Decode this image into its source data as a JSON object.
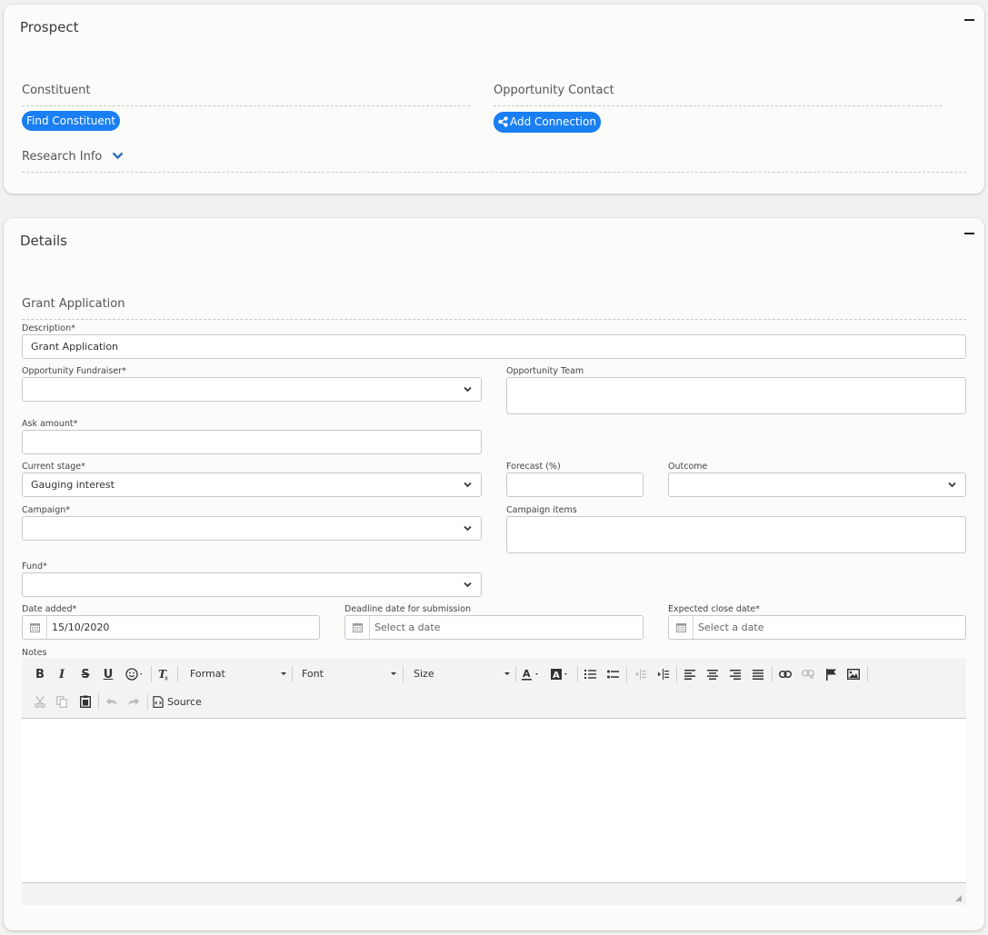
{
  "prospect": {
    "title": "Prospect",
    "constituent_label": "Constituent",
    "find_constituent": "Find Constituent",
    "opportunity_contact_label": "Opportunity Contact",
    "add_connection": "Add Connection",
    "research_info": "Research Info"
  },
  "details": {
    "title": "Details",
    "section": "Grant Application",
    "description_label": "Description*",
    "description_value": "Grant Application",
    "fundraiser_label": "Opportunity Fundraiser*",
    "team_label": "Opportunity Team",
    "ask_label": "Ask amount*",
    "stage_label": "Current stage*",
    "stage_value": "Gauging interest",
    "forecast_label": "Forecast (%)",
    "outcome_label": "Outcome",
    "campaign_label": "Campaign*",
    "campaign_items_label": "Campaign items",
    "fund_label": "Fund*",
    "date_added_label": "Date added*",
    "date_added_value": "15/10/2020",
    "deadline_label": "Deadline date for submission",
    "deadline_placeholder": "Select a date",
    "close_label": "Expected close date*",
    "close_placeholder": "Select a date",
    "notes_label": "Notes"
  },
  "editor": {
    "format": "Format",
    "font": "Font",
    "size": "Size",
    "source": "Source"
  },
  "colors": {
    "accent": "#1a7ff2",
    "chevron": "#2f6fb8"
  }
}
